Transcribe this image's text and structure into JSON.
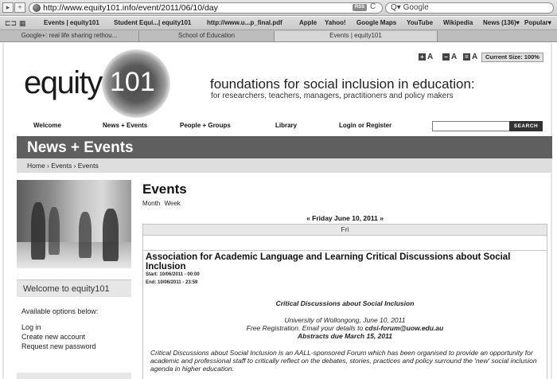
{
  "browser": {
    "url": "http://www.equity101.info/event/2011/06/10/day",
    "rss_label": "RSS",
    "reload_symbol": "C",
    "search_placeholder": "Q▾ Google",
    "bookmarks": [
      "Events | equity101",
      "Student Equi...| equity101",
      "http://www.u...p_final.pdf",
      "Apple",
      "Yahoo!",
      "Google Maps",
      "YouTube",
      "Wikipedia",
      "News (136)▾",
      "Popular▾"
    ],
    "tabs": [
      "Google+: real life sharing rethou...",
      "School of Education",
      "Events | equity101"
    ]
  },
  "site": {
    "logo_word": "equity",
    "logo_number": "101",
    "tagline": "foundations for social inclusion in education:",
    "subtagline": "for researchers, teachers, managers, practitioners and policy makers",
    "text_size": {
      "large": "A",
      "small": "A",
      "reset": "A",
      "current": "Current Size: 100%"
    },
    "nav": [
      "Welcome",
      "News + Events",
      "People + Groups",
      "Library",
      "Login or Register"
    ],
    "search_button": "SEARCH",
    "section_title": "News + Events",
    "breadcrumb": "Home › Events › Events"
  },
  "sidebar": {
    "welcome": "Welcome to equity101",
    "options_label": "Available options below:",
    "links": [
      "Log in",
      "Create new account",
      "Request new password"
    ]
  },
  "main": {
    "heading": "Events",
    "views": [
      "Month",
      "Week"
    ],
    "day_nav": "« Friday June 10, 2011 »",
    "column_header": "Fri",
    "event": {
      "title": "Association for Academic Language and Learning Critical Discussions about Social Inclusion",
      "start": "Start: 10/06/2011 - 00:00",
      "end": "End: 10/06/2011 - 23:59",
      "subtitle": "Critical Discussions about Social Inclusion",
      "venue": "University of Wollongong, June 10, 2011",
      "registration_prefix": "Free Registration. Email your details to ",
      "registration_email": "cdsi-forum@uow.edu.au",
      "abstracts": "Abstracts due March 15, 2011",
      "description": "Critical Discussions about Social Inclusion is an AALL-sponsored Forum which has been organised to provide an opportunity for academic and professional staff to critically reflect on the debates, stories, practices and policy surround the 'new' social inclusion agenda in higher education."
    }
  }
}
